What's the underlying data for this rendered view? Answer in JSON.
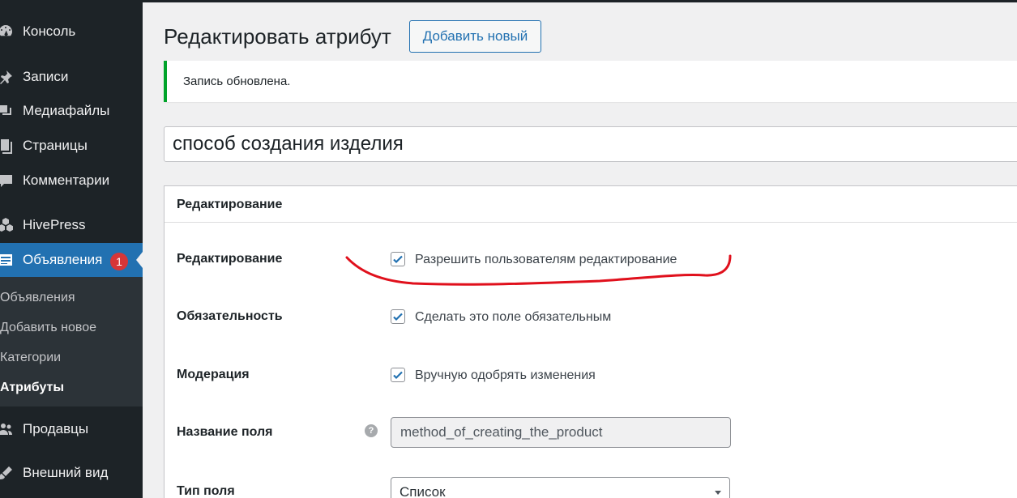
{
  "sidebar": {
    "items": [
      {
        "label": "Консоль"
      },
      {
        "label": "Записи"
      },
      {
        "label": "Медиафайлы"
      },
      {
        "label": "Страницы"
      },
      {
        "label": "Комментарии"
      },
      {
        "label": "HivePress"
      },
      {
        "label": "Объявления",
        "badge": "1"
      },
      {
        "label": "Продавцы"
      },
      {
        "label": "Внешний вид"
      }
    ],
    "submenu": [
      {
        "label": "Объявления"
      },
      {
        "label": "Добавить новое"
      },
      {
        "label": "Категории"
      },
      {
        "label": "Атрибуты"
      }
    ]
  },
  "header": {
    "title": "Редактировать атрибут",
    "add_new_label": "Добавить новый"
  },
  "notice": {
    "text": "Запись обновлена."
  },
  "title_field": {
    "value": "способ создания изделия"
  },
  "panel": {
    "title": "Редактирование",
    "rows": [
      {
        "label": "Редактирование",
        "checkbox_label": "Разрешить пользователям редактирование",
        "checked": true
      },
      {
        "label": "Обязательность",
        "checkbox_label": "Сделать это поле обязательным",
        "checked": true
      },
      {
        "label": "Модерация",
        "checkbox_label": "Вручную одобрять изменения",
        "checked": true
      }
    ],
    "field_name": {
      "label": "Название поля",
      "value": "method_of_creating_the_product"
    },
    "field_type": {
      "label": "Тип поля",
      "value": "Список"
    }
  },
  "colors": {
    "accent": "#2271b1",
    "sidebar_bg": "#1d2327",
    "success": "#00a32a",
    "badge": "#d63638",
    "annotation": "#e0101c"
  }
}
